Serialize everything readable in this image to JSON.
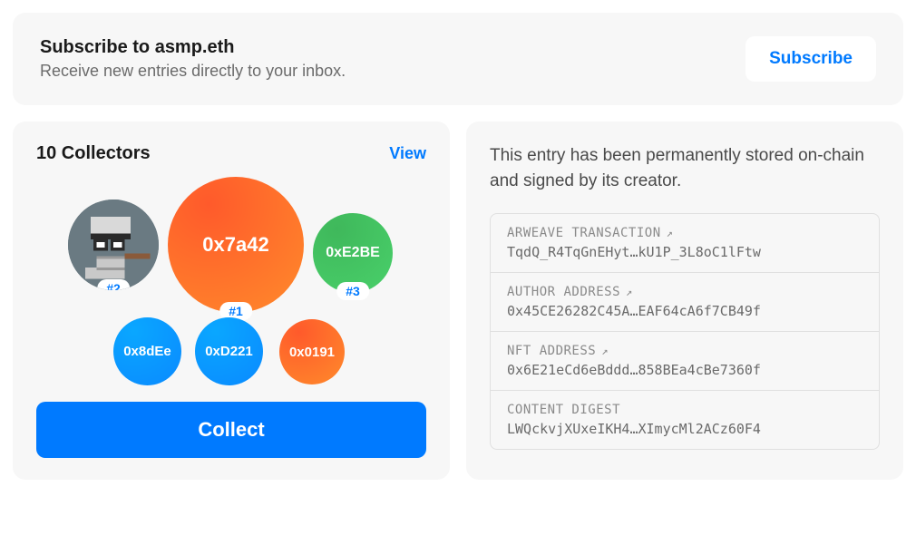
{
  "subscribe": {
    "title": "Subscribe to asmp.eth",
    "subtitle": "Receive new entries directly to your inbox.",
    "button": "Subscribe"
  },
  "collectors": {
    "title": "10 Collectors",
    "view": "View",
    "collect_button": "Collect",
    "bubbles": {
      "rank1": {
        "label": "0x7a42",
        "badge": "#1"
      },
      "rank2": {
        "badge": "#2"
      },
      "rank3": {
        "label": "0xE2BE",
        "badge": "#3"
      },
      "small1": {
        "label": "0x8dEe"
      },
      "small2": {
        "label": "0xD221"
      },
      "small3": {
        "label": "0x0191"
      }
    }
  },
  "chain": {
    "description": "This entry has been permanently stored on-chain and signed by its creator.",
    "items": [
      {
        "label": "ARWEAVE TRANSACTION",
        "value": "TqdQ_R4TqGnEHyt…kU1P_3L8oC1lFtw",
        "link": true
      },
      {
        "label": "AUTHOR ADDRESS",
        "value": "0x45CE26282C45A…EAF64cA6f7CB49f",
        "link": true
      },
      {
        "label": "NFT ADDRESS",
        "value": "0x6E21eCd6eBddd…858BEa4cBe7360f",
        "link": true
      },
      {
        "label": "CONTENT DIGEST",
        "value": "LWQckvjXUxeIKH4…XImycMl2ACz60F4",
        "link": false
      }
    ]
  }
}
